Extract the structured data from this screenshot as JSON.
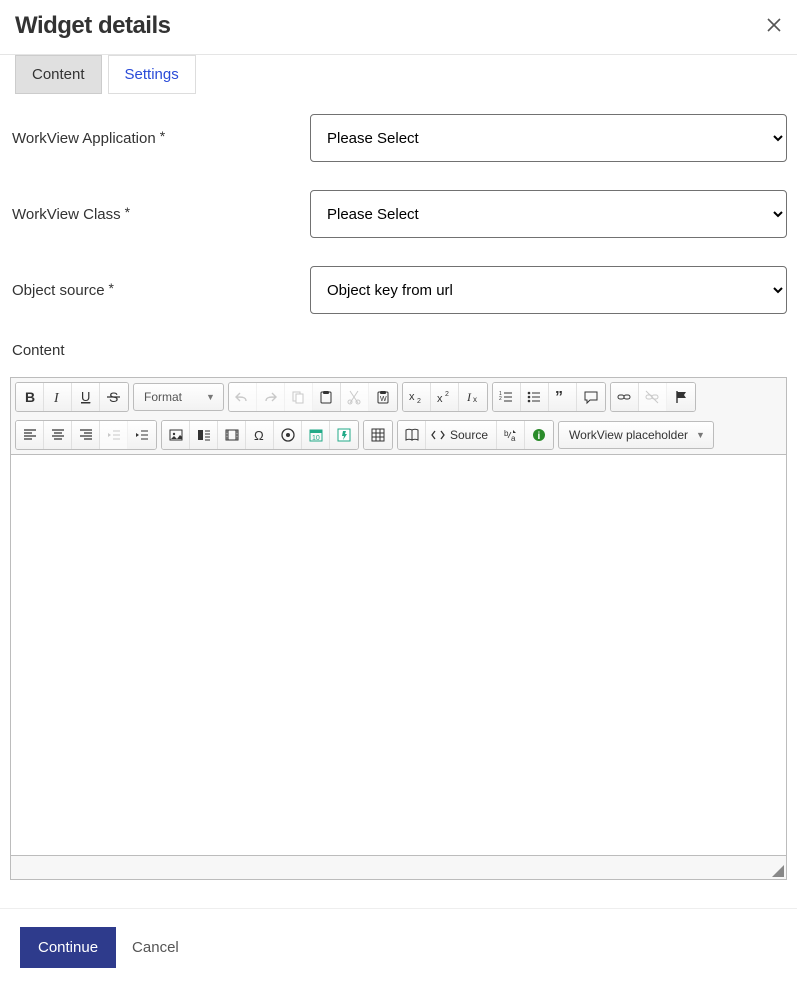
{
  "header": {
    "title": "Widget details"
  },
  "tabs": {
    "content": "Content",
    "settings": "Settings"
  },
  "form": {
    "app_label": "WorkView Application",
    "app_value": "Please Select",
    "class_label": "WorkView Class",
    "class_value": "Please Select",
    "source_label": "Object source",
    "source_value": "Object key from url",
    "content_label": "Content"
  },
  "toolbar": {
    "format_label": "Format",
    "source_label": "Source",
    "wv_label": "WorkView placeholder"
  },
  "footer": {
    "continue": "Continue",
    "cancel": "Cancel"
  }
}
